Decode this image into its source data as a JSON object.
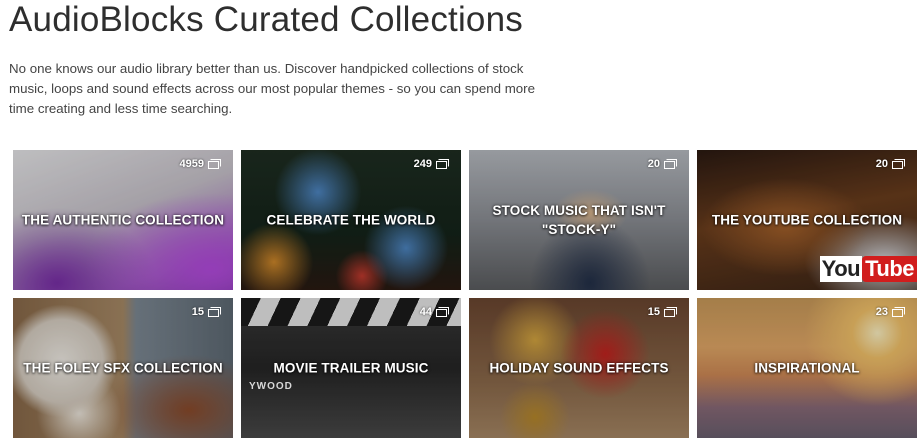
{
  "header": {
    "title": "AudioBlocks Curated Collections",
    "intro": "No one knows our audio library better than us. Discover handpicked collections of stock music, loops and sound effects across our most popular themes - so you can spend more time creating and less time searching."
  },
  "collections": [
    {
      "title": "THE AUTHENTIC COLLECTION",
      "count": "4959"
    },
    {
      "title": "CELEBRATE THE WORLD",
      "count": "249"
    },
    {
      "title": "STOCK MUSIC THAT ISN'T \"STOCK-Y\"",
      "count": "20"
    },
    {
      "title": "THE YOUTUBE COLLECTION",
      "count": "20",
      "logo": {
        "you": "You",
        "tube": "Tube"
      }
    },
    {
      "title": "THE FOLEY SFX COLLECTION",
      "count": "15"
    },
    {
      "title": "MOVIE TRAILER MUSIC",
      "count": "44",
      "slate_text": "YWOOD"
    },
    {
      "title": "HOLIDAY SOUND EFFECTS",
      "count": "15"
    },
    {
      "title": "INSPIRATIONAL",
      "count": "23"
    }
  ],
  "icons": {
    "count_icon": "stack-icon"
  }
}
